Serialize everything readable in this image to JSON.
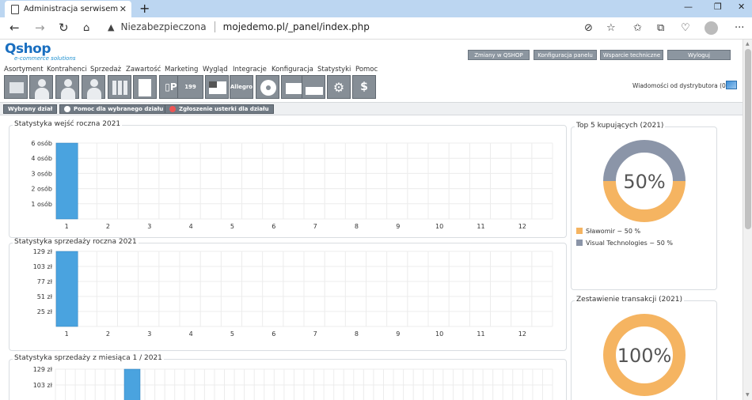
{
  "browser": {
    "tab_title": "Administracja serwisem",
    "insecure_label": "Niezabezpieczona",
    "url": "mojedemo.pl/_panel/index.php"
  },
  "app": {
    "logo": "Qshop",
    "logo_sub": "e-commerce solutions",
    "top_buttons": [
      "Zmiany w QSHOP",
      "Konfiguracja panelu",
      "Wsparcie techniczne",
      "Wyloguj"
    ],
    "menu": [
      "Asortyment",
      "Kontrahenci",
      "Sprzedaż",
      "Zawartość",
      "Marketing",
      "Wygląd",
      "Integracje",
      "Konfiguracja",
      "Statystyki",
      "Pomoc"
    ],
    "messages": "Wiadomości od dystrybutora (0)",
    "toolbar_icons": [
      "box-icon",
      "client-icon",
      "client2-icon",
      "user-icon",
      "grid-icon",
      "docs-icon",
      "parking-icon",
      "counter-icon",
      "window-icon",
      "allegro-icon",
      "cd-icon",
      "folder-icon",
      "chart-icon",
      "gear-icon",
      "price-icon"
    ],
    "allegro_label": "Allegro",
    "counter_label": "199",
    "strip_buttons": [
      "Wybrany dział",
      "Pomoc dla wybranego działu",
      "Zgłoszenie usterki dla działu"
    ]
  },
  "panels": {
    "entries": {
      "title": "Statystyka wejść roczna 2021"
    },
    "sales": {
      "title": "Statystyka sprzedaży roczna 2021"
    },
    "monthly": {
      "title": "Statystyka sprzedaży z miesiąca 1 / 2021"
    },
    "top5": {
      "title": "Top 5 kupujących (2021)",
      "center": "50%",
      "legend": [
        {
          "label": "Sławomir ~ 50 %",
          "color": "#f5b461"
        },
        {
          "label": "Visual Technologies ~ 50 %",
          "color": "#8b95a8"
        }
      ]
    },
    "transactions": {
      "title": "Zestawienie transakcji (2021)",
      "center": "100%"
    }
  },
  "chart_data": [
    {
      "type": "bar",
      "title": "Statystyka wejść roczna 2021",
      "categories": [
        "1",
        "2",
        "3",
        "4",
        "5",
        "6",
        "7",
        "8",
        "9",
        "10",
        "11",
        "12"
      ],
      "values": [
        6,
        0,
        0,
        0,
        0,
        0,
        0,
        0,
        0,
        0,
        0,
        0
      ],
      "yticks": [
        "6 osób",
        "4 osób",
        "3 osób",
        "2 osób",
        "1 osób"
      ],
      "color": "#4aa3df"
    },
    {
      "type": "bar",
      "title": "Statystyka sprzedaży roczna 2021",
      "categories": [
        "1",
        "2",
        "3",
        "4",
        "5",
        "6",
        "7",
        "8",
        "9",
        "10",
        "11",
        "12"
      ],
      "values": [
        129,
        0,
        0,
        0,
        0,
        0,
        0,
        0,
        0,
        0,
        0,
        0
      ],
      "yticks": [
        "129 zł",
        "103 zł",
        "77 zł",
        "51 zł",
        "25 zł"
      ],
      "color": "#4aa3df"
    },
    {
      "type": "bar",
      "title": "Statystyka sprzedaży z miesiąca 1 / 2021",
      "yticks": [
        "129 zł",
        "103 zł"
      ],
      "values": [
        0,
        0,
        0,
        129
      ],
      "color": "#4aa3df"
    },
    {
      "type": "pie",
      "title": "Top 5 kupujących (2021)",
      "labels": [
        "Sławomir",
        "Visual Technologies"
      ],
      "values": [
        50,
        50
      ],
      "colors": [
        "#f5b461",
        "#8b95a8"
      ]
    },
    {
      "type": "pie",
      "title": "Zestawienie transakcji (2021)",
      "values": [
        100
      ],
      "colors": [
        "#f5b461"
      ]
    }
  ]
}
